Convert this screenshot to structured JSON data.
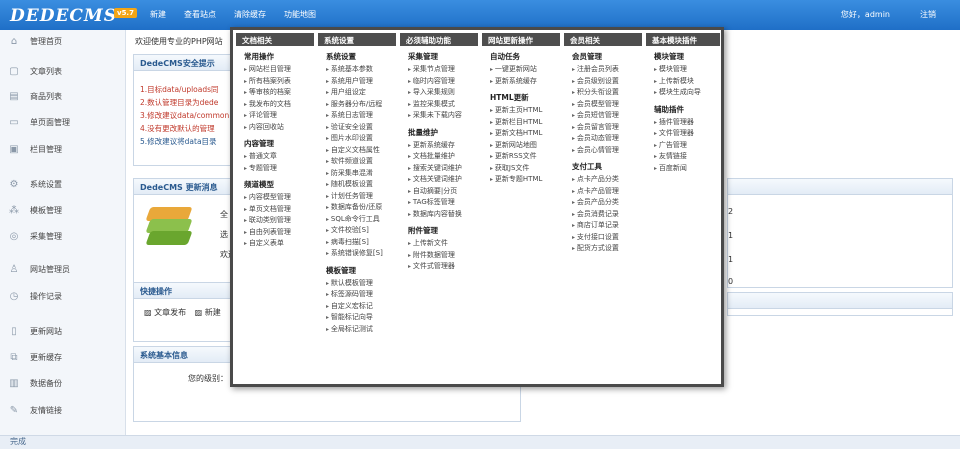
{
  "topbar": {
    "logo": "DEDECMS",
    "version": "v5.7",
    "nav": [
      "新建",
      "查看站点",
      "清除缓存",
      "功能地图"
    ],
    "user": "您好，admin",
    "exit": "注销"
  },
  "sidebar": {
    "items": [
      {
        "label": "管理首页",
        "icon": "home-icon"
      },
      {
        "label": "文章列表",
        "icon": "article-icon"
      },
      {
        "label": "商品列表",
        "icon": "goods-icon"
      },
      {
        "label": "单页面管理",
        "icon": "page-icon"
      },
      {
        "label": "栏目管理",
        "icon": "column-icon"
      },
      {
        "label": "系统设置",
        "icon": "settings-icon"
      },
      {
        "label": "模板管理",
        "icon": "template-icon"
      },
      {
        "label": "采集管理",
        "icon": "collect-icon"
      },
      {
        "label": "网站管理员",
        "icon": "admin-icon"
      },
      {
        "label": "操作记录",
        "icon": "log-icon"
      },
      {
        "label": "更新网站",
        "icon": "update-icon"
      },
      {
        "label": "更新缓存",
        "icon": "cache-icon"
      },
      {
        "label": "数据备份",
        "icon": "backup-icon"
      },
      {
        "label": "友情链接",
        "icon": "link-icon"
      }
    ]
  },
  "main": {
    "welcome": "欢迎使用专业的PHP网站",
    "security_title": "DedeCMS安全提示",
    "tips": [
      "1.目标data/uploads同",
      "2.数认管理目录为dede",
      "3.修改建议data/common",
      "4.没有更改默认的管理",
      "5.修改建议将data目录"
    ],
    "update_title": "DedeCMS 更新消息",
    "update_lines": [
      "全",
      "选",
      "欢迎"
    ],
    "right_nums": [
      "2",
      "1",
      "1",
      "0"
    ],
    "quick_title": "快捷操作",
    "quick_items": [
      "文章发布",
      "新建"
    ],
    "sysinfo_title": "系统基本信息",
    "sysinfo_label": "您的级别："
  },
  "statusbar": "完成",
  "menu": {
    "columns": [
      {
        "title": "文档相关",
        "groups": [
          {
            "name": "常用操作",
            "items": [
              "网站栏目管理",
              "所有档案列表",
              "等审核的档案",
              "我发布的文档",
              "评论管理",
              "内容回收站"
            ]
          },
          {
            "name": "内容管理",
            "items": [
              "普通文章",
              "专题管理"
            ]
          },
          {
            "name": "频道模型",
            "items": [
              "内容模型管理",
              "单页文档管理",
              "联动类别管理",
              "自由列表管理",
              "自定义表单"
            ]
          }
        ]
      },
      {
        "title": "系统设置",
        "groups": [
          {
            "name": "系统设置",
            "items": [
              "系统基本参数",
              "系统用户管理",
              "用户组设定",
              "服务器分布/远程",
              "系统日志管理",
              "验证安全设置",
              "图片水印设置",
              "自定义文档属性",
              "软件频道设置",
              "防采集串混淆",
              "随机模板设置",
              "计划任务管理",
              "数据库备份/还原",
              "SQL命令行工具",
              "文件校验[S]",
              "病毒扫描[S]",
              "系统错误修复[S]"
            ]
          },
          {
            "name": "模板管理",
            "items": [
              "默认模板管理",
              "标签源码管理",
              "自定义宏标记",
              "智能标记向导",
              "全局标记测试"
            ]
          }
        ]
      },
      {
        "title": "必须辅助功能",
        "groups": [
          {
            "name": "采集管理",
            "items": [
              "采集节点管理",
              "临时内容管理",
              "导入采集规则",
              "监控采集模式",
              "采集未下载内容"
            ]
          },
          {
            "name": "批量维护",
            "items": [
              "更新系统缓存",
              "文档批量维护",
              "搜索关键词维护",
              "文档关键词维护",
              "自动摘要|分页",
              "TAG标签管理",
              "数据库内容替换"
            ]
          },
          {
            "name": "附件管理",
            "items": [
              "上传新文件",
              "附件数据管理",
              "文件式管理器"
            ]
          }
        ]
      },
      {
        "title": "网站更新操作",
        "groups": [
          {
            "name": "自动任务",
            "items": [
              "一键更新网站",
              "更新系统缓存"
            ]
          },
          {
            "name": "HTML更新",
            "items": [
              "更新主页HTML",
              "更新栏目HTML",
              "更新文档HTML",
              "更新网站地图",
              "更新RSS文件",
              "获取JS文件",
              "更新专题HTML"
            ]
          }
        ]
      },
      {
        "title": "会员相关",
        "groups": [
          {
            "name": "会员管理",
            "items": [
              "注册会员列表",
              "会员级别设置",
              "积分头衔设置",
              "会员模型管理",
              "会员短信管理",
              "会员留言管理",
              "会员动态管理",
              "会员心情管理"
            ]
          },
          {
            "name": "支付工具",
            "items": [
              "点卡产品分类",
              "点卡产品管理",
              "会员产品分类",
              "会员消费记录",
              "商店订单记录",
              "支付接口设置",
              "配货方式设置"
            ]
          }
        ]
      },
      {
        "title": "基本模块插件",
        "groups": [
          {
            "name": "模块管理",
            "items": [
              "模块管理",
              "上传新模块",
              "模块生成向导"
            ]
          },
          {
            "name": "辅助插件",
            "items": [
              "插件管理器",
              "文件管理器",
              "广告管理",
              "友情链接",
              "百度新闻"
            ]
          }
        ]
      }
    ]
  },
  "colors": {
    "topbar": "#2a7fd6",
    "menu_header": "#4e4e4e",
    "tip_red": "#c0392b",
    "panel_title": "#2a5a8f"
  }
}
